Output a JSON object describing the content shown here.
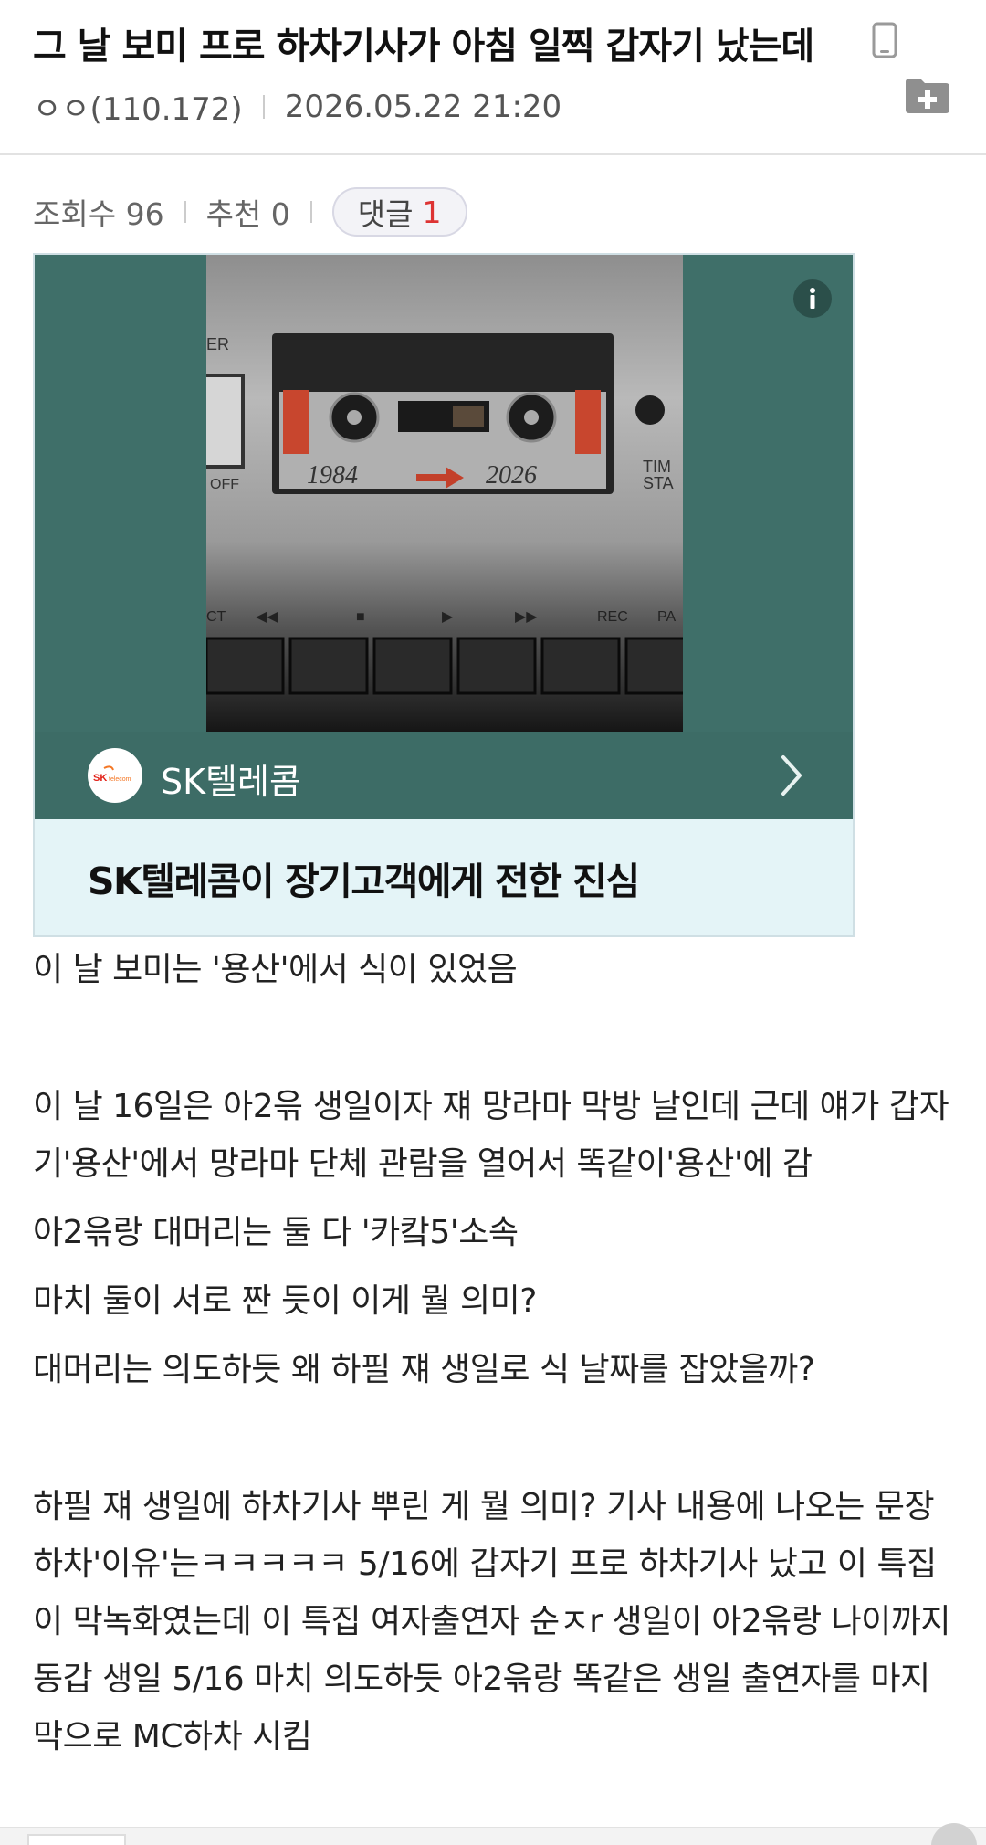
{
  "post": {
    "title": "그 날 보미 프로 하차기사가 아침 일찍 갑자기 났는데",
    "author": "ㅇㅇ(110.172)",
    "datetime": "2026.05.22 21:20"
  },
  "stats": {
    "views_label": "조회수 96",
    "recommend_label": "추천 0",
    "comments_label": "댓글",
    "comments_count": "1"
  },
  "ad": {
    "cassette_left": "1984",
    "cassette_right": "2026",
    "deck_labels": [
      "ER",
      "OFF",
      "TIM",
      "STA",
      "CT",
      "◀◀",
      "■",
      "▶",
      "▶▶",
      "REC",
      "PA"
    ],
    "brand_name": "SK텔레콤",
    "logo_text": "SK telecom",
    "headline": "SK텔레콤이 장기고객에게 전한 진심",
    "colors": {
      "brand_bar": "#3d6c66",
      "card_bg": "#e4f4f7"
    }
  },
  "content": {
    "paragraphs": [
      "이 날 보미는 '용산'에서 식이 있었음",
      "",
      "이 날 16일은 아2윾 생일이자 쟤 망라마 막방 날인데 근데 얘가 갑자기'용산'에서 망라마 단체 관람을 열어서 똑같이'용산'에 감",
      "아2윾랑 대머리는 둘 다 '카캌5'소속",
      "마치 둘이 서로 짠 듯이 이게 뭘 의미?",
      "대머리는 의도하듯 왜 하필 쟤 생일로 식 날짜를 잡았을까?",
      "",
      "하필 쟤 생일에 하차기사 뿌린 게 뭘 의미? 기사 내용에 나오는 문장 하차'이유'는ㅋㅋㅋㅋㅋ 5/16에 갑자기 프로 하차기사 났고 이 특집이 막녹화였는데 이 특집 여자출연자 순ㅈr 생일이 아2윾랑 나이까지 동갑 생일 5/16 마치 의도하듯 아2윾랑 똑같은 생일 출연자를 마지막으로 MC하차 시킴"
    ]
  },
  "icons": {
    "mobile": "mobile-phone-icon",
    "folder": "folder-add-icon",
    "info": "info-icon",
    "chevron": "chevron-right-icon"
  }
}
